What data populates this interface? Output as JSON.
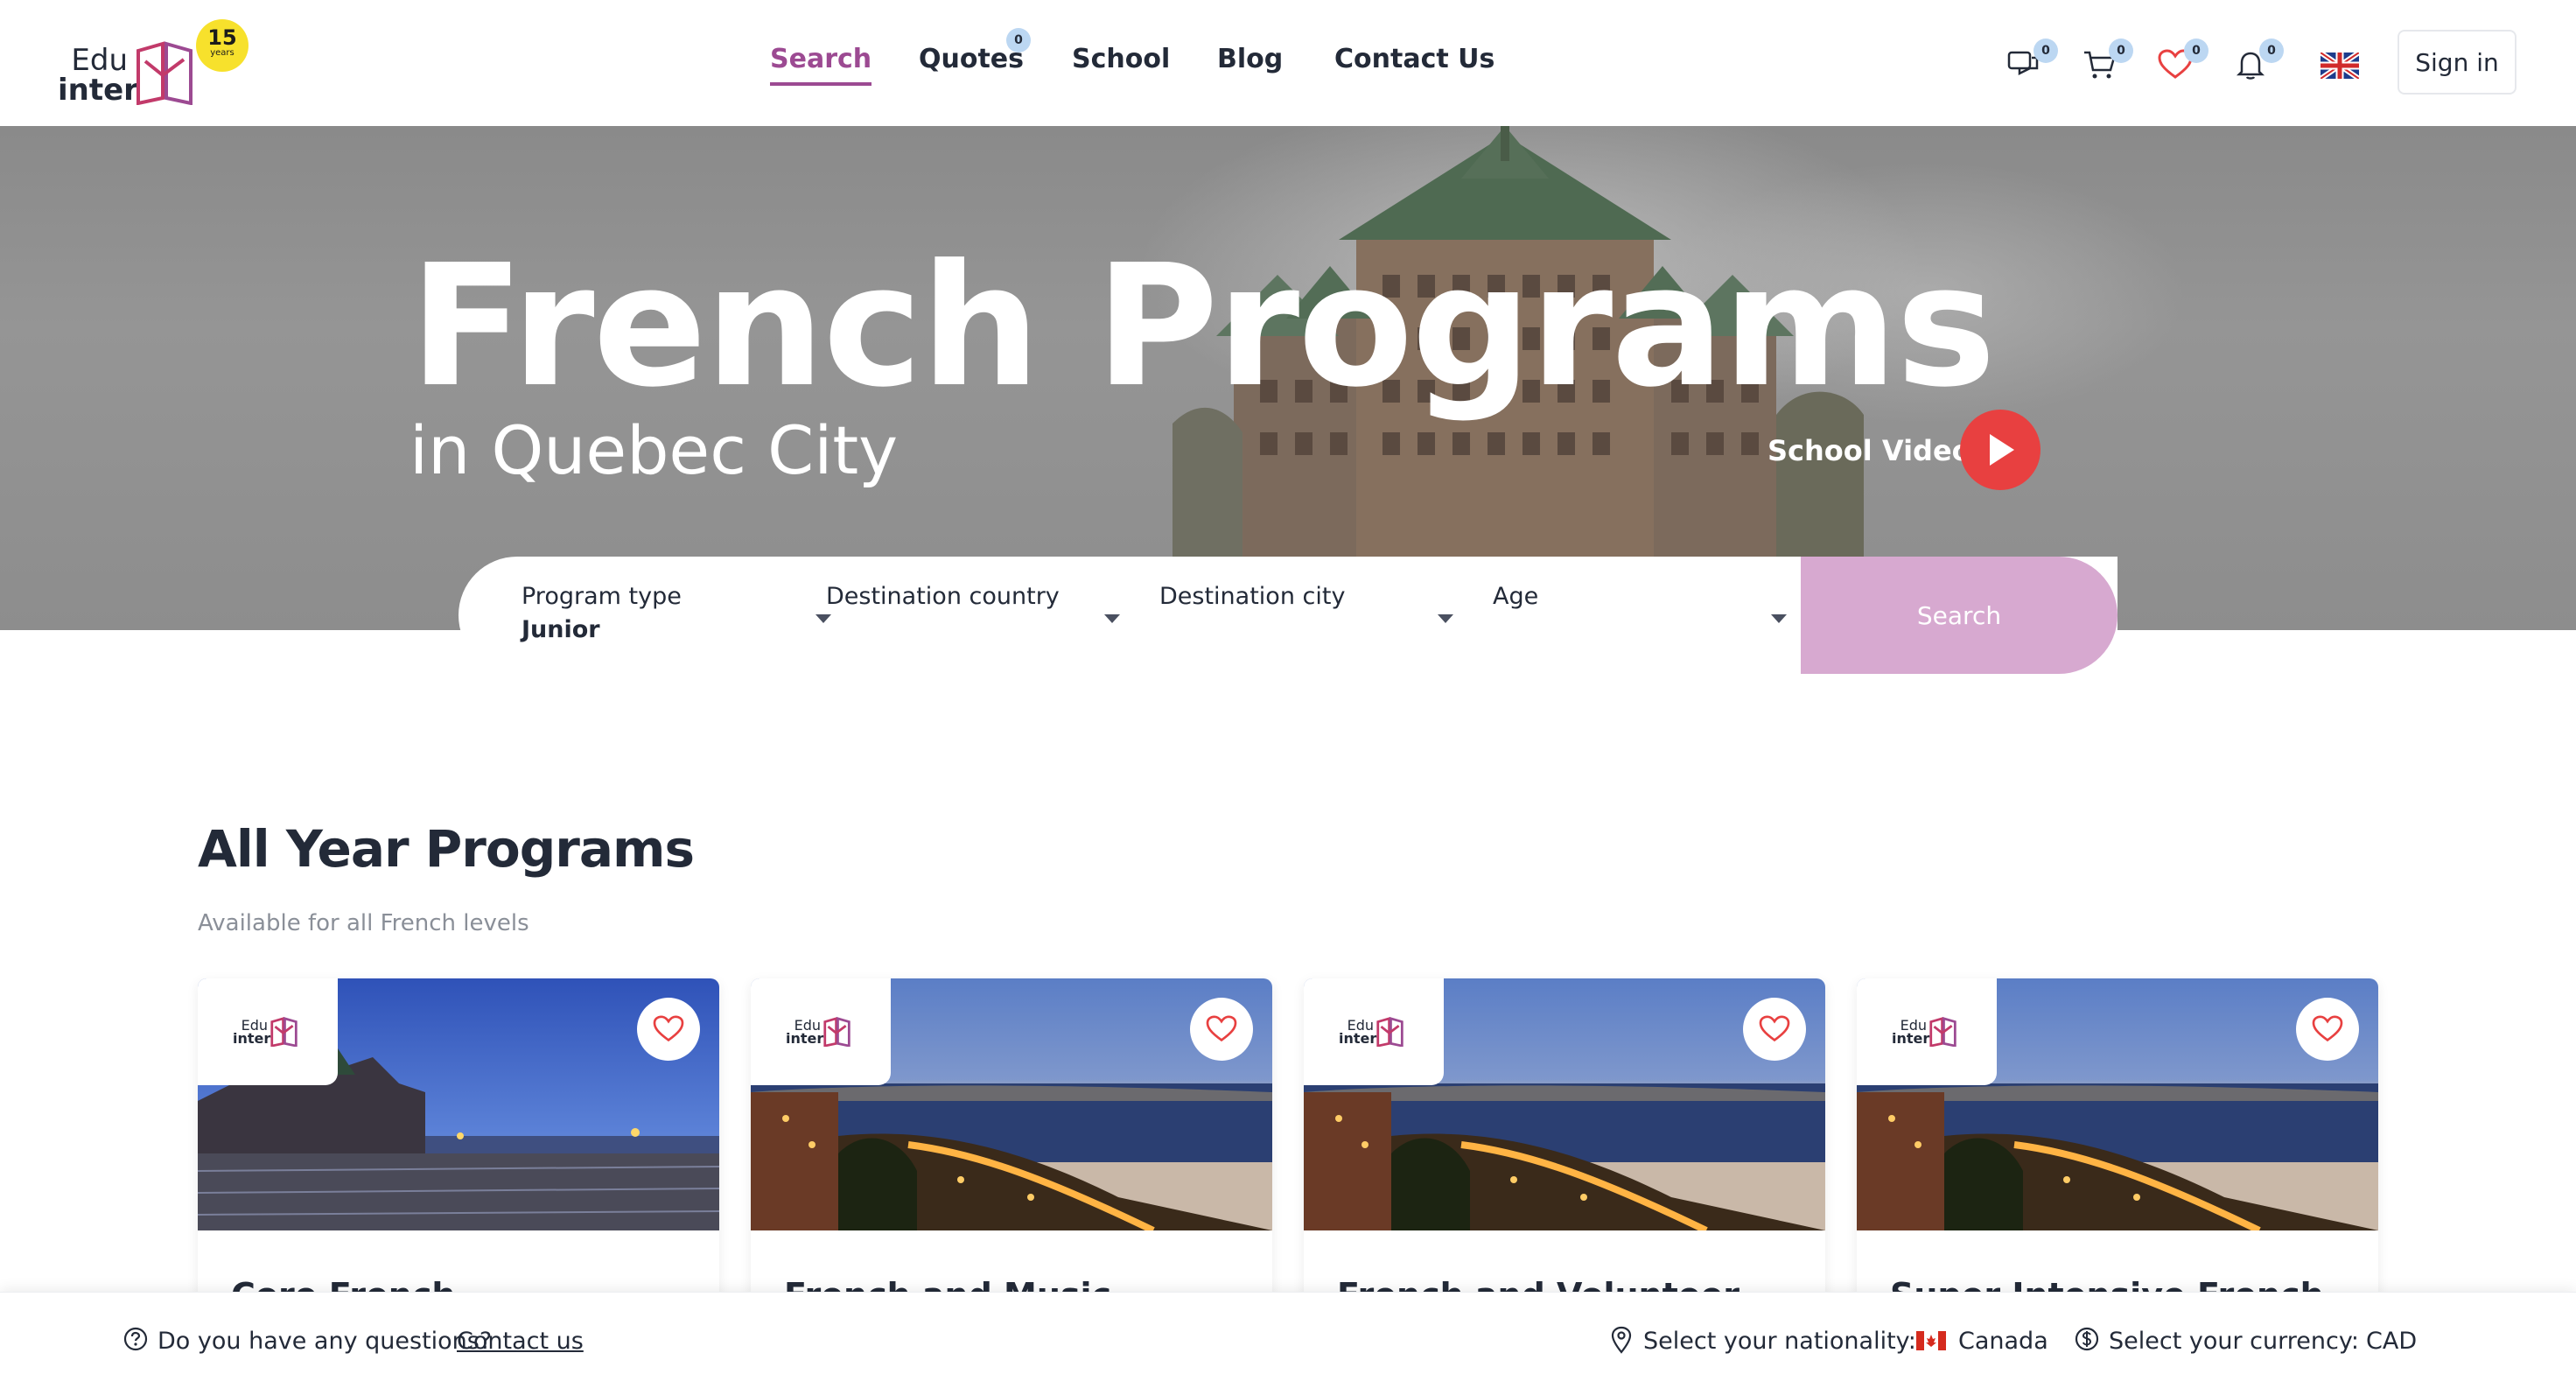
{
  "brand": {
    "logo_line1": "Edu",
    "logo_line2": "inter",
    "badge_number": "15",
    "badge_word": "years"
  },
  "nav": {
    "items": [
      {
        "label": "Search",
        "active": true
      },
      {
        "label": "Quotes",
        "badge": "0"
      },
      {
        "label": "School"
      },
      {
        "label": "Blog"
      },
      {
        "label": "Contact Us"
      }
    ]
  },
  "actions": {
    "messages_count": "0",
    "cart_count": "0",
    "favorites_count": "0",
    "notifications_count": "0",
    "language_icon": "uk-flag-icon",
    "signin_label": "Sign in"
  },
  "hero": {
    "title": "French Programs",
    "subtitle": "in Quebec City",
    "video_label": "School Video"
  },
  "search": {
    "fields": [
      {
        "label": "Program type",
        "value": "Junior"
      },
      {
        "label": "Destination country",
        "value": ""
      },
      {
        "label": "Destination city",
        "value": ""
      },
      {
        "label": "Age",
        "value": ""
      }
    ],
    "button_label": "Search"
  },
  "section": {
    "title": "All Year Programs",
    "subtitle": "Available for all French levels",
    "cards": [
      {
        "title": "Core French",
        "image": "chateau-boardwalk"
      },
      {
        "title": "French and Music",
        "image": "city-night"
      },
      {
        "title": "French and Volunteer",
        "image": "city-night"
      },
      {
        "title": "Super Intensive French",
        "image": "city-night"
      }
    ],
    "card_logo_line1": "Edu",
    "card_logo_line2": "inter"
  },
  "footer": {
    "question": "Do you have any questions?",
    "contact_link": "Contact us",
    "nationality_label": "Select your nationality:",
    "nationality_value": "Canada",
    "currency_label": "Select your currency:",
    "currency_value": "CAD"
  },
  "colors": {
    "accent": "#9c4a92",
    "search_button": "#d7a9d0",
    "play_button": "#e84040",
    "count_badge": "#bcd7f2",
    "text": "#232a38",
    "muted": "#8a8f98",
    "badge_yellow": "#f7e12c"
  }
}
